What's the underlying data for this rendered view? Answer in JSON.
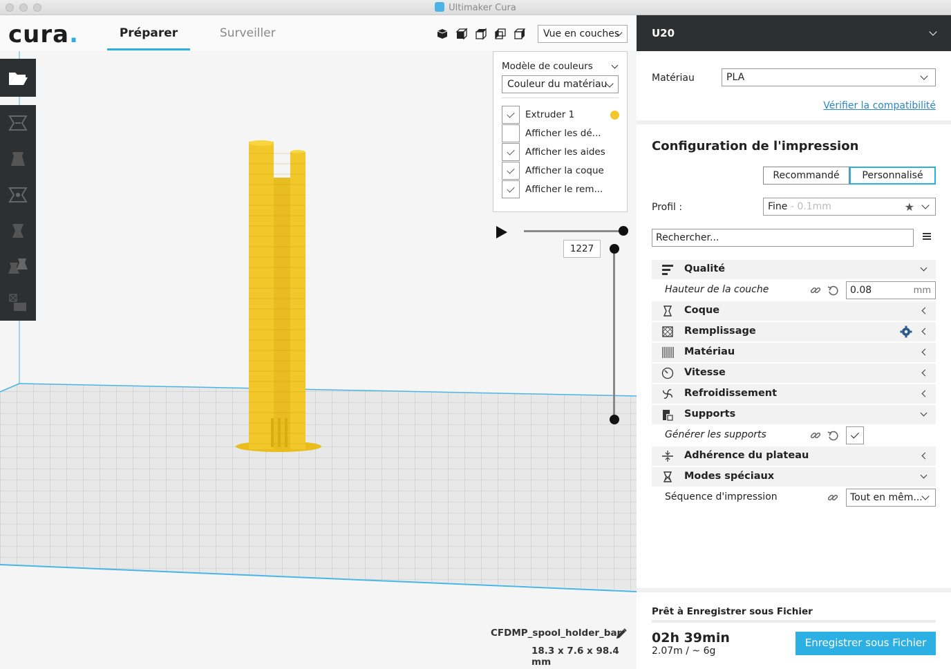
{
  "window": {
    "title": "Ultimaker Cura"
  },
  "header": {
    "logo": "cura",
    "tabs": [
      {
        "label": "Préparer",
        "active": true
      },
      {
        "label": "Surveiller",
        "active": false
      }
    ],
    "view_icons": [
      "3d-view-icon",
      "front-view-icon",
      "top-view-icon",
      "left-view-icon",
      "right-view-icon"
    ],
    "view_select": "Vue en couches"
  },
  "toolbar": {
    "tools": [
      "open-file-icon",
      "move-icon",
      "scale-icon",
      "rotate-icon",
      "mirror-icon",
      "per-model-settings-icon",
      "support-blocker-icon"
    ]
  },
  "color_panel": {
    "title": "Modèle de couleurs",
    "scheme": "Couleur du matériau",
    "options": [
      {
        "label": "Extruder 1",
        "checked": true,
        "color": "#f2c72a"
      },
      {
        "label": "Afficher les dé...",
        "checked": false
      },
      {
        "label": "Afficher les aides",
        "checked": true
      },
      {
        "label": "Afficher la coque",
        "checked": true
      },
      {
        "label": "Afficher le rem...",
        "checked": true
      }
    ]
  },
  "layer": {
    "current": "1227"
  },
  "object": {
    "name": "CFDMP_spool_holder_bar",
    "dims": "18.3 x 7.6 x 98.4 mm"
  },
  "sidebar": {
    "printer": "U20",
    "material_label": "Matériau",
    "material_value": "PLA",
    "compat_link": "Vérifier la compatibilité",
    "config_title": "Configuration de l'impression",
    "mode_recommended": "Recommandé",
    "mode_custom": "Personnalisé",
    "profile_label": "Profil :",
    "profile_value": "Fine",
    "profile_sub": " - 0.1mm",
    "search_placeholder": "Rechercher...",
    "categories": {
      "qualite": "Qualité",
      "coque": "Coque",
      "remplissage": "Remplissage",
      "materiau": "Matériau",
      "vitesse": "Vitesse",
      "refroidissement": "Refroidissement",
      "supports": "Supports",
      "adherence": "Adhérence du plateau",
      "modes": "Modes spéciaux"
    },
    "settings": {
      "layer_height_label": "Hauteur de la couche",
      "layer_height_value": "0.08",
      "layer_height_unit": "mm",
      "gen_supports_label": "Générer les supports",
      "gen_supports_checked": true,
      "print_seq_label": "Séquence d'impression",
      "print_seq_value": "Tout en mêm..."
    },
    "ready": "Prêt à Enregistrer sous Fichier",
    "time": "02h 39min",
    "usage": "2.07m / ~ 6g",
    "save_button": "Enregistrer sous Fichier"
  },
  "colors": {
    "accent": "#2cb0e4",
    "model": "#f2c72a",
    "dark": "#2d3033"
  }
}
